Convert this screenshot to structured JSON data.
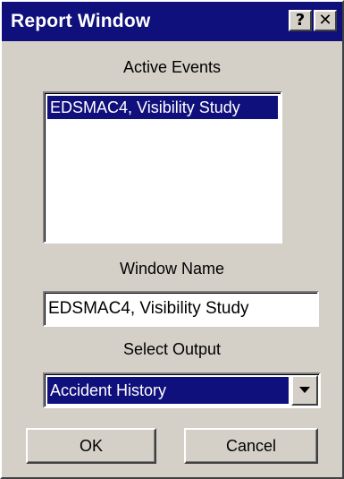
{
  "window": {
    "title": "Report Window",
    "help_button": "?",
    "close_button": "✕"
  },
  "active_events": {
    "label": "Active Events",
    "items": [
      "EDSMAC4, Visibility Study"
    ],
    "selected_index": 0
  },
  "window_name": {
    "label": "Window Name",
    "value": "EDSMAC4, Visibility Study"
  },
  "select_output": {
    "label": "Select Output",
    "value": "Accident History"
  },
  "buttons": {
    "ok": "OK",
    "cancel": "Cancel"
  },
  "colors": {
    "title_bar": "#10107c",
    "selection": "#10107c",
    "face": "#d4d0c8"
  }
}
